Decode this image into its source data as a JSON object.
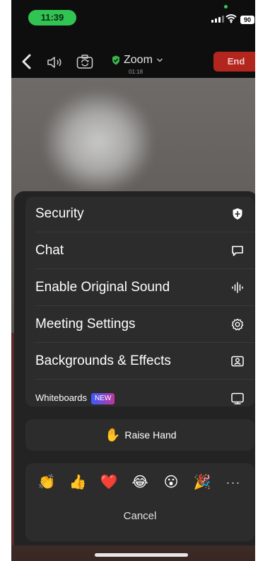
{
  "status_bar": {
    "time": "11:39",
    "battery": "90"
  },
  "toolbar": {
    "title": "Zoom",
    "elapsed": "01:18",
    "end_label": "End"
  },
  "menu": {
    "items": [
      {
        "label": "Security",
        "icon": "shield-icon"
      },
      {
        "label": "Chat",
        "icon": "chat-bubble-icon"
      },
      {
        "label": "Enable Original Sound",
        "icon": "sound-wave-icon"
      },
      {
        "label": "Meeting Settings",
        "icon": "gear-icon"
      },
      {
        "label": "Backgrounds & Effects",
        "icon": "portrait-frame-icon"
      },
      {
        "label": "Whiteboards",
        "badge": "NEW",
        "icon": "whiteboard-icon"
      }
    ]
  },
  "raise_hand": {
    "label": "Raise Hand"
  },
  "reactions": {
    "emojis": [
      "👏",
      "👍",
      "❤️",
      "😂",
      "😮",
      "🎉"
    ],
    "more": "···",
    "cancel_label": "Cancel"
  },
  "colors": {
    "end_button": "#b3261e",
    "time_pill": "#31c452",
    "sheet": "#232323",
    "card": "#2c2c2c"
  }
}
